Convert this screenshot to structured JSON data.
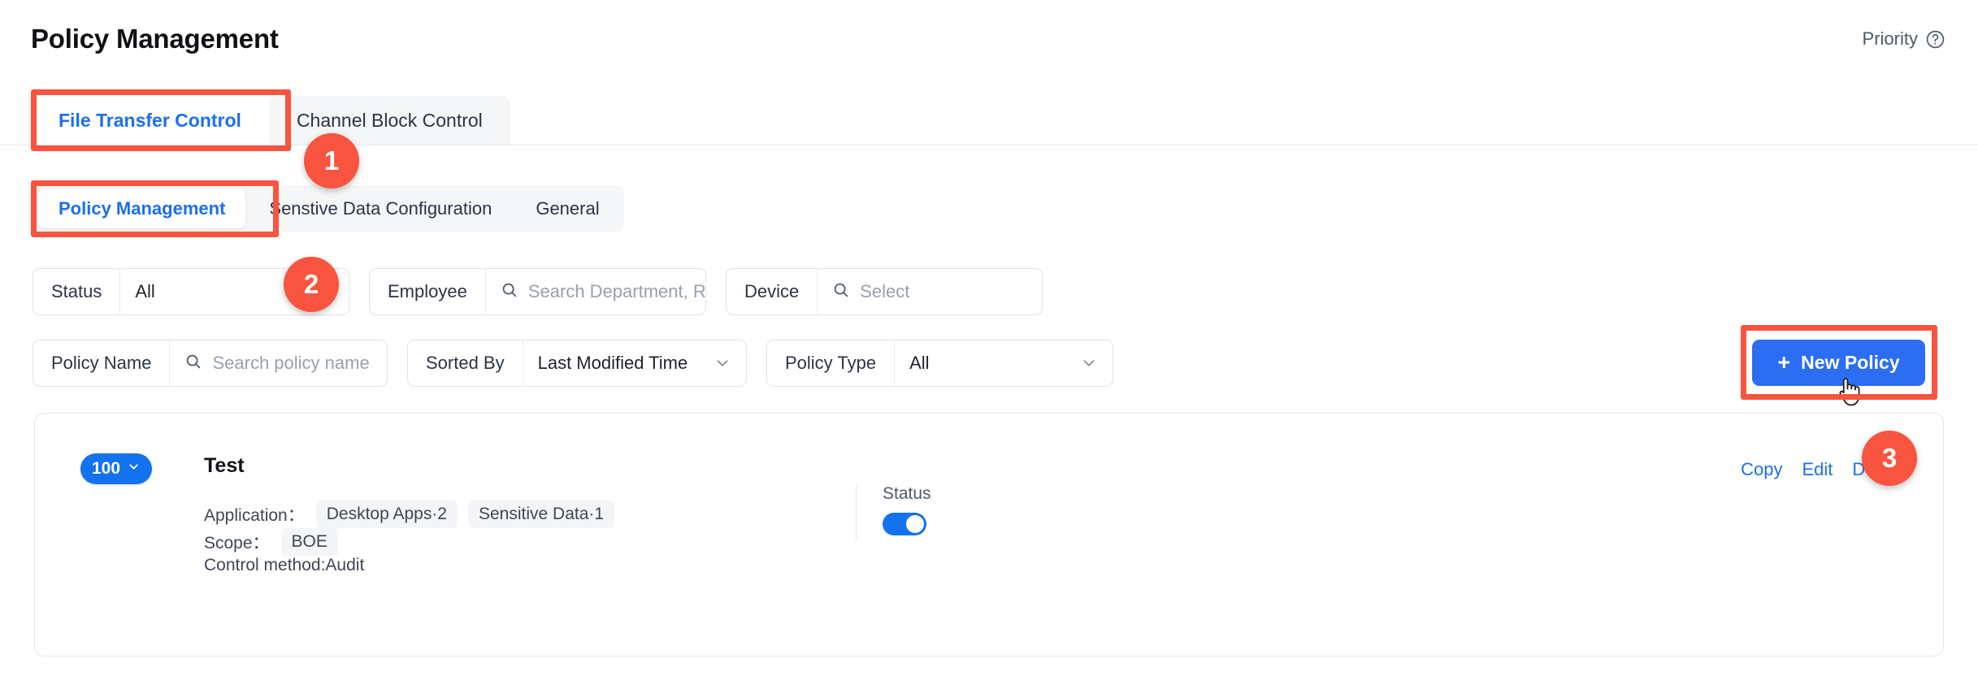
{
  "header": {
    "title": "Policy Management",
    "priority_label": "Priority",
    "help_icon": "help-circle-icon"
  },
  "primary_tabs": [
    {
      "label": "File Transfer Control",
      "active": true
    },
    {
      "label": "Channel Block Control",
      "active": false
    }
  ],
  "secondary_tabs": [
    {
      "label": "Policy Management",
      "active": true
    },
    {
      "label": "Senstive Data Configuration",
      "active": false
    },
    {
      "label": "General",
      "active": false
    }
  ],
  "filters": {
    "status": {
      "label": "Status",
      "value": "All",
      "icon": "chevron-down-icon"
    },
    "employee": {
      "label": "Employee",
      "placeholder": "Search Department, Role, Membe",
      "icon": "search-icon"
    },
    "device": {
      "label": "Device",
      "placeholder": "Select",
      "icon": "search-icon"
    },
    "policy_name": {
      "label": "Policy Name",
      "placeholder": "Search policy name",
      "icon": "search-icon"
    },
    "sorted_by": {
      "label": "Sorted By",
      "value": "Last Modified Time",
      "icon": "chevron-down-icon"
    },
    "policy_type": {
      "label": "Policy Type",
      "value": "All",
      "icon": "chevron-down-icon"
    }
  },
  "new_policy_button": {
    "label": "New Policy",
    "plus": "+",
    "icon": "plus-icon",
    "color": "#2b6ef2"
  },
  "policy_card": {
    "priority": "100",
    "priority_icon": "chevron-down-icon",
    "name": "Test",
    "application_label": "Application：",
    "application_chips": [
      "Desktop Apps·2",
      "Sensitive Data·1"
    ],
    "scope_label": "Scope：",
    "scope_chips": [
      "BOE"
    ],
    "control_method": "Control method:Audit",
    "status_label": "Status",
    "status_on": true,
    "actions": [
      "Copy",
      "Edit",
      "Delete"
    ]
  },
  "annotations": {
    "badges": [
      "1",
      "2",
      "3"
    ],
    "color": "#f9543f"
  }
}
